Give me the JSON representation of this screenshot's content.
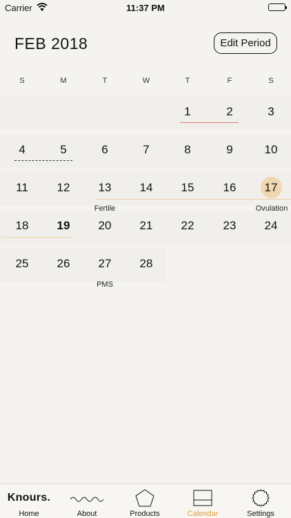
{
  "status_bar": {
    "carrier": "Carrier",
    "time": "11:37 PM"
  },
  "header": {
    "month": "FEB 2018",
    "edit_button": "Edit Period"
  },
  "weekdays": [
    "S",
    "M",
    "T",
    "W",
    "T",
    "F",
    "S"
  ],
  "weeks": [
    [
      "",
      "",
      "",
      "",
      "1",
      "2",
      "3"
    ],
    [
      "4",
      "5",
      "6",
      "7",
      "8",
      "9",
      "10"
    ],
    [
      "11",
      "12",
      "13",
      "14",
      "15",
      "16",
      "17"
    ],
    [
      "18",
      "19",
      "20",
      "21",
      "22",
      "23",
      "24"
    ],
    [
      "25",
      "26",
      "27",
      "28",
      "",
      "",
      ""
    ]
  ],
  "labels": {
    "fertile": "Fertile",
    "ovulation": "Ovulation",
    "pms": "PMS"
  },
  "colors": {
    "accent": "#e3a03c",
    "period_line": "#e07c74",
    "ovulation": "#f0d7b1"
  },
  "tabs": [
    {
      "label": "Home",
      "icon": "knours-logo",
      "logo_text": "Knours."
    },
    {
      "label": "About",
      "icon": "wave-icon"
    },
    {
      "label": "Products",
      "icon": "pentagon-icon"
    },
    {
      "label": "Calendar",
      "icon": "calendar-icon",
      "active": true
    },
    {
      "label": "Settings",
      "icon": "gear-icon"
    }
  ]
}
